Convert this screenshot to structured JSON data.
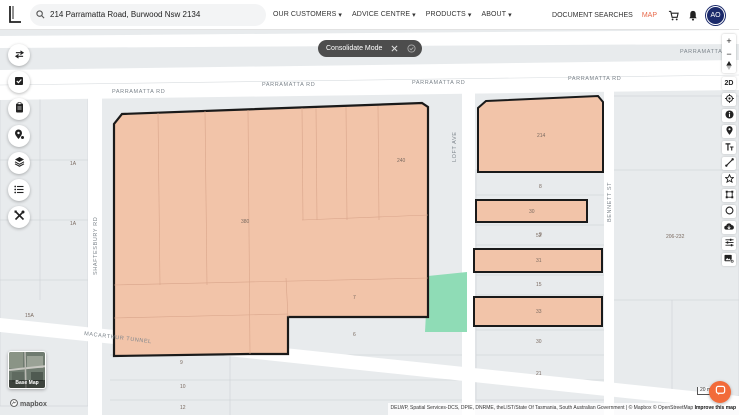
{
  "header": {
    "search_value": "214 Parramatta Road, Burwood Nsw 2134",
    "nav": [
      "OUR CUSTOMERS",
      "ADVICE CENTRE",
      "PRODUCTS",
      "ABOUT"
    ],
    "document_searches": "DOCUMENT SEARCHES",
    "map_link": "MAP",
    "avatar_initials": "AO"
  },
  "consolidate": {
    "label": "Consolidate Mode"
  },
  "right_tools": {
    "mode_label": "2D"
  },
  "basemap": {
    "label": "Base Map"
  },
  "map": {
    "road_labels": [
      "PARRAMATTA RD",
      "PARRAMATTA RD",
      "PARRAMATTA RD",
      "PARRAMATTA RD",
      "PARRAMATTA RD",
      "SHAFTESBURY RD",
      "LOFT AVE",
      "BENNETT ST",
      "MACARTHUR TUNNEL"
    ],
    "lot_labels": [
      "380",
      "240",
      "214",
      "7",
      "6",
      "30",
      "31",
      "33",
      "8",
      "9",
      "52",
      "15",
      "30",
      "21",
      "206-232",
      "1A",
      "1A",
      "15A",
      "9",
      "10",
      "12"
    ],
    "colors": {
      "selected_fill": "#f2c4a9",
      "selected_stroke": "#1a1a1a",
      "park": "#8fdcb6",
      "road": "#ffffff",
      "block": "#eaedef",
      "accent": "#e8694a"
    }
  },
  "attribution": {
    "text": "DELWP, Spatial Services-DCS, DPIE, DNRME, theLIST/State Of Tasmania, South Australian Government | © Mapbox © OpenStreetMap",
    "improve": "Improve this map"
  },
  "mapbox_logo": "mapbox",
  "scale_label": "20 m"
}
